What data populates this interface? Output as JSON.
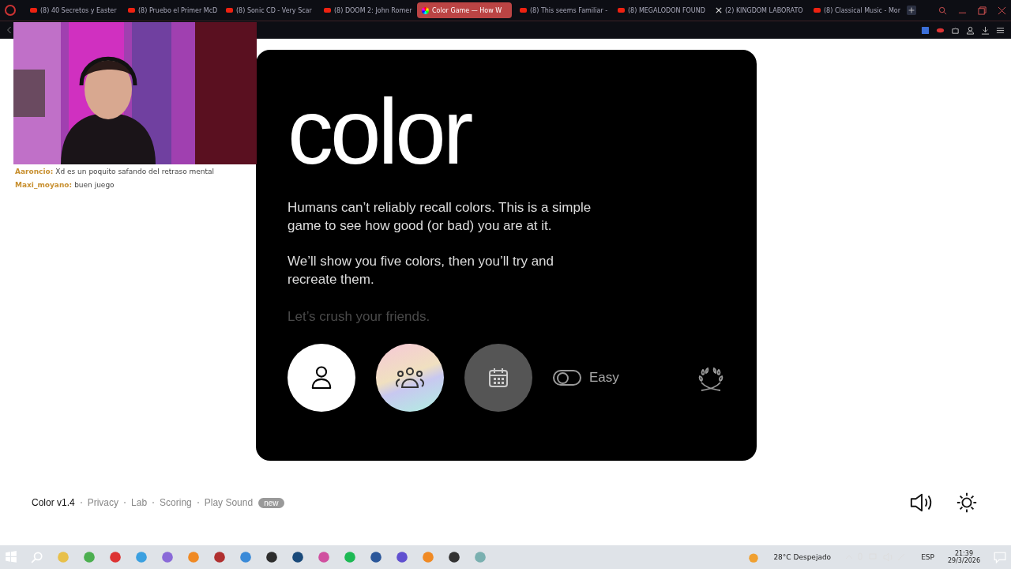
{
  "browser": {
    "tabs": [
      {
        "title": "(8) 40 Secretos y Easter",
        "kind": "youtube",
        "selected": false
      },
      {
        "title": "(8) Pruebo el Primer McD",
        "kind": "youtube",
        "selected": false
      },
      {
        "title": "(8) Sonic CD - Very Scar",
        "kind": "youtube",
        "selected": false
      },
      {
        "title": "(8) DOOM 2: John Romer",
        "kind": "youtube",
        "selected": false
      },
      {
        "title": "Color Game — How W",
        "kind": "game",
        "selected": true
      },
      {
        "title": "(8) This seems Familiar -",
        "kind": "youtube",
        "selected": false
      },
      {
        "title": "(8) MEGALODON FOUND",
        "kind": "youtube",
        "selected": false
      },
      {
        "title": "(2) KINGDOM LABORATO",
        "kind": "x",
        "selected": false
      },
      {
        "title": "(8) Classical Music - Mor",
        "kind": "youtube",
        "selected": false
      }
    ]
  },
  "stream_overlay": {
    "chat": [
      {
        "user": "Aaroncio:",
        "message": "Xd es un poquito safando del retraso mental"
      },
      {
        "user": "Maxi_moyano:",
        "message": "buen juego"
      }
    ]
  },
  "game": {
    "title": "color",
    "paragraphs": [
      "Humans can’t reliably recall colors. This is a simple game to see how good (or bad) you are at it.",
      "We’ll show you five colors, then you’ll try and recreate them."
    ],
    "tagline": "Let’s crush your friends.",
    "modes": [
      {
        "kind": "solo"
      },
      {
        "kind": "multi"
      },
      {
        "kind": "daily"
      }
    ],
    "difficulty": {
      "label": "Easy",
      "on": false
    }
  },
  "footer": {
    "version": "Color v1.4",
    "links": [
      {
        "label": "Privacy"
      },
      {
        "label": "Lab"
      },
      {
        "label": "Scoring"
      },
      {
        "label": "Play Sound",
        "badge": "new"
      }
    ]
  },
  "taskbar": {
    "weather": "28°C Despejado",
    "language": "ESP",
    "time": "21:39",
    "date": "29/3/2026"
  }
}
